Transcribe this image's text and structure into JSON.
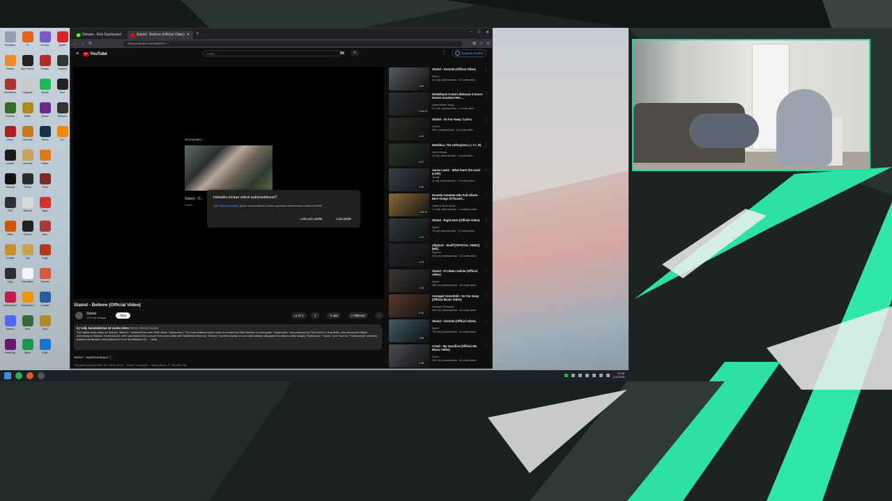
{
  "browser": {
    "tabs": [
      {
        "label": "Stream - Kick Dashboard",
        "color": "#53fc18"
      },
      {
        "label": "Staind - Believe (Official Video)",
        "color": "#ff0000"
      }
    ],
    "url": "www.youtube.com/watch?v=..."
  },
  "youtube": {
    "logo_text": "YouTube",
    "search_placeholder": "Haku",
    "sign_in": "Kirjaudu sisään",
    "endcard": {
      "label": "Seuraavaksi",
      "title": "Staind - O...",
      "channel": "Staind"
    },
    "dialog": {
      "title": "Haluatko toistaa videot automaattisesti?",
      "body_prefix": "Voit",
      "body_link": "kirjautua sisään",
      "body_suffix": "jolloin automaattisen toiston asetukset tallennetaan kaikille laitteille.",
      "btn_off": "Laita pois päältä",
      "btn_on": "Laita päälle"
    },
    "video": {
      "title": "Staind - Believe (Official Video)",
      "channel": "Staind",
      "subscribers": "1,03 milj. tilaajaa",
      "subscribe": "Tilaa",
      "likes": "47 t.",
      "share": "Jaa",
      "save": "Tallenna",
      "meta": "8,7 milj. katselukertaa  16 vuotta sitten",
      "tags": "#Rock #Metal #Staind",
      "description": "The official music video for Staind's \"Believe,\" released from their 1999 album \"Dysfunction.\" The track features Aaron Lewis on vocals and Mike Mushok on lead guitar. \"Dysfunction\" was produced by Fred Durst of Limp Bizkit, who discovered Staind performing in Hartford, Connecticut in 1997 and helped them secure their record deal with Flip/Elektra Records. \"Believe\" received airplay on rock radio stations alongside the album's other singles \"Mudshovel,\" \"Home,\" and \"Just Go.\" \"Dysfunction\" achieved platinum certification and peaked at #74 on the Billboard 20... ...lisää",
      "chapters": "Staind – tapahtumaluput",
      "chapter_bar": "Tiet tapahtumaa  Mansfield, MA, Xfinity Center   ...   Staind + Mudvayne   ...   Sturgis Beach, FL, Dirt Bike Park"
    },
    "recommendations": [
      {
        "title": "Staind - Outside (Official Video)",
        "channel": "Staind",
        "views": "8,4 milj. katselukertaa · 16 vuotta sitten",
        "duration": "4:50",
        "color": "#555a5e"
      },
      {
        "title": "Nickelback Creed Lifehouse 3 Doors Downs Greatest Hits ...",
        "channel": "Isabel Meiner Tango",
        "views": "9,1 milj. katselukertaa · 3 vuotta sitten",
        "duration": "3:34:13",
        "color": "#2c3136"
      },
      {
        "title": "Staind - So Far Away / Lyrics",
        "channel": "Tell me",
        "views": "990 t. katselukertaa · 16 vuotta sitten",
        "duration": "4:04",
        "color": "#2d2a24"
      },
      {
        "title": "Metallica: The Unforgiven ( L Y L R)",
        "channel": "Willie Klamar",
        "views": "10 milj. katselukertaa · 9 vuotta sitten",
        "duration": "6:21",
        "color": "#28352a"
      },
      {
        "title": "Aaron Lewis - What hurts the most (LIVE)",
        "channel": "Vikvall",
        "views": "11 milj. katselukertaa · 12 vuotta sitten",
        "duration": "5:30",
        "color": "#3b3f4a"
      },
      {
        "title": "Roxette Greatest Hits Full Album - Best Songs Of Roxett...",
        "channel": "Online & Rock Music",
        "views": "1,9 milj. katselukertaa · 1 kuukausi sitten",
        "duration": "1:26:19",
        "color": "#8a6b3a"
      },
      {
        "title": "Staind - Right Here (Official Video)",
        "channel": "Staind",
        "views": "78 milj. katselukertaa · 16 vuotta sitten",
        "duration": "4:13",
        "color": "#2d3a3d"
      },
      {
        "title": "Slipknot - Snuff [OFFICIAL VIDEO] [HD]",
        "channel": "Slipknot",
        "views": "202 milj. katselukertaa · 16 vuotta sitten",
        "duration": "4:23",
        "color": "#22252a"
      },
      {
        "title": "Staind - It's Been Awhile (Official Video)",
        "channel": "Staind",
        "views": "589 milj. katselukertaa · 16 vuotta sitten",
        "duration": "4:34",
        "color": "#3a3633"
      },
      {
        "title": "Avenged Sevenfold - So Far Away (Official Music Video)",
        "channel": "Avenged Sevenfold",
        "views": "638 milj. katselukertaa · 16 vuotta sitten",
        "duration": "5:29",
        "color": "#5a3a2a"
      },
      {
        "title": "Staind - Outside (Official Video)",
        "channel": "Staind",
        "views": "758 milj. katselukertaa · 16 vuotta sitten",
        "duration": "4:56",
        "color": "#3f5a66"
      },
      {
        "title": "Creed - My Sacrifice (Official HD Music Video)",
        "channel": "Creed",
        "views": "280 milj. katselukertaa · 16 vuotta sitten",
        "duration": "4:48",
        "color": "#4a4d52"
      }
    ]
  },
  "desktop": {
    "icons": [
      {
        "label": "Roskakori",
        "color": "#8fa0b0"
      },
      {
        "label": "Fx",
        "color": "#e5651b"
      },
      {
        "label": "Exodus",
        "color": "#7a5ac8"
      },
      {
        "label": "Adobe",
        "color": "#d4262c"
      },
      {
        "label": "Firefox",
        "color": "#f08a24"
      },
      {
        "label": "Epic Games",
        "color": "#222222"
      },
      {
        "label": "Escape",
        "color": "#b52a2a"
      },
      {
        "label": "Logitech",
        "color": "#333333"
      },
      {
        "label": "BlueStacks",
        "color": "#a33"
      },
      {
        "label": "Hogwarts",
        "color": "#c9c9c9"
      },
      {
        "label": "Spotify",
        "color": "#1db954"
      },
      {
        "label": "Kick",
        "color": "#222222"
      },
      {
        "label": "Zombies",
        "color": "#356c2a"
      },
      {
        "label": "Battle",
        "color": "#b4891c"
      },
      {
        "label": "Quake",
        "color": "#6a2a8a"
      },
      {
        "label": "Notepad",
        "color": "#333333"
      },
      {
        "label": "Game",
        "color": "#aa1f1f"
      },
      {
        "label": "Overwolf",
        "color": "#c77a1f"
      },
      {
        "label": "Steam",
        "color": "#16324b"
      },
      {
        "label": "VLC",
        "color": "#f28a00"
      },
      {
        "label": "Counter",
        "color": "#1a1a1a"
      },
      {
        "label": "Launcher",
        "color": "#c8a35a"
      },
      {
        "label": "Player",
        "color": "#e07b1a"
      },
      {
        "label": "",
        "color": "transparent"
      },
      {
        "label": "Valorant",
        "color": "#111111"
      },
      {
        "label": "Teams",
        "color": "#2b2b2b"
      },
      {
        "label": "Tools",
        "color": "#7a2a2a"
      },
      {
        "label": "",
        "color": "transparent"
      },
      {
        "label": "OBS",
        "color": "#302e31"
      },
      {
        "label": "Network",
        "color": "#d8d8d8"
      },
      {
        "label": "Maps",
        "color": "#c33"
      },
      {
        "label": "",
        "color": "transparent"
      },
      {
        "label": "Office",
        "color": "#d35400"
      },
      {
        "label": "Discord",
        "color": "#222"
      },
      {
        "label": "Apex",
        "color": "#a83a3a"
      },
      {
        "label": "",
        "color": "transparent"
      },
      {
        "label": "Counter",
        "color": "#c3902a"
      },
      {
        "label": "City",
        "color": "#c9a347"
      },
      {
        "label": "Origin",
        "color": "#b0381e"
      },
      {
        "label": "",
        "color": "transparent"
      },
      {
        "label": "Days",
        "color": "#2d2d2d"
      },
      {
        "label": "Overwatch",
        "color": "#f5f5f5"
      },
      {
        "label": "Transfer",
        "color": "#d45a3a"
      },
      {
        "label": "",
        "color": "transparent"
      },
      {
        "label": "Dead Island",
        "color": "#c51a4a"
      },
      {
        "label": "Overwatch 2",
        "color": "#f29400"
      },
      {
        "label": "Counter",
        "color": "#2a5aa0"
      },
      {
        "label": "",
        "color": "transparent"
      },
      {
        "label": "Discord",
        "color": "#5865f2"
      },
      {
        "label": "Rust",
        "color": "#3a6a3a"
      },
      {
        "label": "Truck",
        "color": "#b08a2a"
      },
      {
        "label": "",
        "color": "transparent"
      },
      {
        "label": "GameSpy",
        "color": "#6a1a6a"
      },
      {
        "label": "Storm",
        "color": "#1a9a4a"
      },
      {
        "label": "Edge",
        "color": "#1a73d0"
      },
      {
        "label": "",
        "color": "transparent"
      }
    ]
  },
  "taskbar": {
    "time": "22.56",
    "date": "8.3.2026"
  }
}
